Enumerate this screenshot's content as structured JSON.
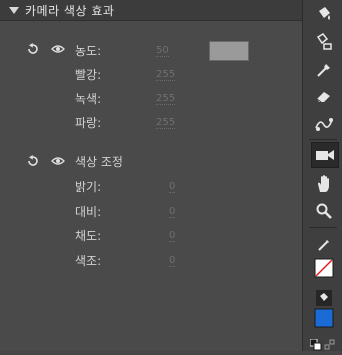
{
  "panel": {
    "title": "카메라 색상 효과"
  },
  "tint": {
    "amount_label": "농도:",
    "amount_value": "50",
    "red_label": "빨강:",
    "red_value": "255",
    "green_label": "녹색:",
    "green_value": "255",
    "blue_label": "파랑:",
    "blue_value": "255",
    "swatch_color": "#9a9a9a"
  },
  "adjust": {
    "heading": "색상 조정",
    "brightness_label": "밝기:",
    "brightness_value": "0",
    "contrast_label": "대비:",
    "contrast_value": "0",
    "saturation_label": "채도:",
    "saturation_value": "0",
    "hue_label": "색조:",
    "hue_value": "0"
  },
  "toolbar": {
    "icons": [
      "paint-bucket-icon",
      "ink-bucket-icon",
      "eyedropper-icon",
      "eraser-icon",
      "bone-icon",
      "camera-icon",
      "hand-icon",
      "zoom-icon",
      "pencil-stroke-icon",
      "bucket-fill-icon"
    ],
    "stroke_color": "none",
    "fill_color": "#1a6bd6"
  }
}
